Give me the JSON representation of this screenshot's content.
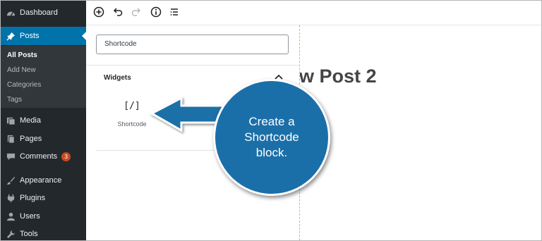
{
  "sidebar": {
    "dashboard": "Dashboard",
    "posts": "Posts",
    "submenu": [
      "All Posts",
      "Add New",
      "Categories",
      "Tags"
    ],
    "media": "Media",
    "pages": "Pages",
    "comments": "Comments",
    "comments_count": "3",
    "appearance": "Appearance",
    "plugins": "Plugins",
    "users": "Users",
    "tools": "Tools"
  },
  "toolbar": {
    "icons": [
      "add-block-icon",
      "undo-icon",
      "redo-icon",
      "info-icon",
      "block-navigation-icon"
    ]
  },
  "inserter": {
    "search_value": "Shortcode",
    "section_title": "Widgets",
    "block_icon": "[/]",
    "block_label": "Shortcode"
  },
  "editor": {
    "title_visible": "w Post 2"
  },
  "callout": {
    "text": "Create a Shortcode block."
  },
  "colors": {
    "sidebar_bg": "#23282d",
    "active_menu": "#0073aa",
    "callout_bg": "#1b6fa8",
    "badge": "#ca4a1f"
  }
}
